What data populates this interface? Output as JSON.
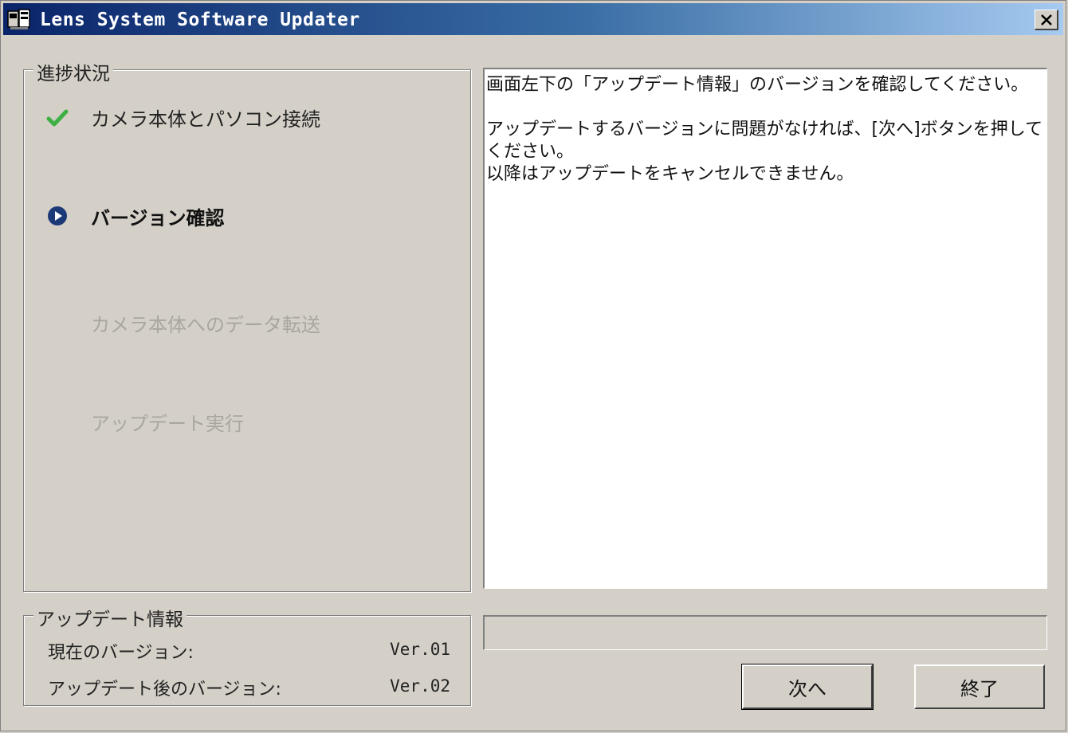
{
  "window": {
    "title": "Lens System Software Updater",
    "colors": {
      "titlebar_start": "#0a246a",
      "titlebar_end": "#a6caf0",
      "face": "#d4d0c8"
    }
  },
  "progress_group": {
    "legend": "進捗状況",
    "steps": [
      {
        "label": "カメラ本体とパソコン接続",
        "state": "done",
        "icon": "checkmark-icon"
      },
      {
        "label": "バージョン確認",
        "state": "active",
        "icon": "play-arrow-icon"
      },
      {
        "label": "カメラ本体へのデータ転送",
        "state": "pending"
      },
      {
        "label": "アップデート実行",
        "state": "pending"
      }
    ]
  },
  "update_info": {
    "legend": "アップデート情報",
    "current_label": "現在のバージョン:",
    "current_value": "Ver.01",
    "after_label": "アップデート後のバージョン:",
    "after_value": "Ver.02"
  },
  "message": {
    "line1": "画面左下の「アップデート情報」のバージョンを確認してください。",
    "line2": "アップデートするバージョンに問題がなければ、[次へ]ボタンを押してください。",
    "line3": "以降はアップデートをキャンセルできません。"
  },
  "progress": {
    "fraction": 0
  },
  "buttons": {
    "next": "次へ",
    "exit": "終了"
  }
}
